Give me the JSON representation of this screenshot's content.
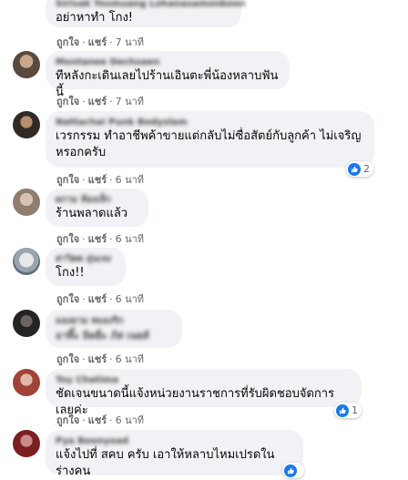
{
  "actions": {
    "like": "ถูกใจ",
    "reply": "แชร์",
    "dot": "·"
  },
  "comments": [
    {
      "author": "Sirisak Yosmuang Lohanasamonkoon",
      "text": "อย่าหาทำ โกง!",
      "time": "7 นาที"
    },
    {
      "author": "Montanee Dechsaen",
      "text": "ทีหลังกะเดินเลยไปร้านเอินตะพี่น้องหลาบฟันนี้",
      "time": "7 นาที"
    },
    {
      "author": "Nattachai Punk Bodyslam",
      "text": "เวรกรรม ทำอาชีพค้าขายแต่กลับไม่ซื่อสัตย์กับลูกค้า ไม่เจริญหรอกครับ",
      "time": "6 นาที",
      "reactions": "2"
    },
    {
      "author": "ผกาม ห้องเล็ก",
      "text": "ร้านพลาดแล้ว",
      "time": "6 นาที"
    },
    {
      "author": "สาวิตต อุ่นเจง",
      "text": "โกง!!",
      "time": "6 นาที"
    },
    {
      "author": "มองยาม หมองริก",
      "text_blurred": "อาทิ๊ะ มิดยิ่ะ ภ้ส เนยส์",
      "time": "6 นาที"
    },
    {
      "author": "Toy Chatima",
      "text": "ชัดเจนขนาดนี้แจ้งหน่วยงานราชการที่รับผิดชอบจัดการเลยค่ะ",
      "time": "6 นาที",
      "reactions": "1"
    },
    {
      "author": "Pya Boonyoad",
      "text": "แจ้งไปที่ สคบ ครับ เอาให้หลาบไหมเปรดในร่างคน"
    }
  ]
}
